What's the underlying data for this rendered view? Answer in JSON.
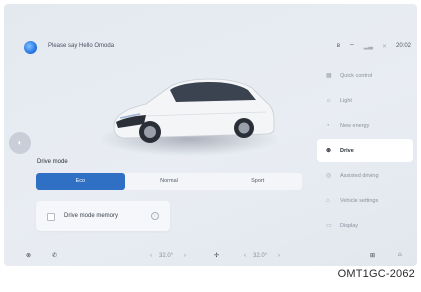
{
  "header": {
    "greeting": "Please say Hello Omoda",
    "status_icons": [
      "bluetooth-icon",
      "wifi-icon",
      "signal-icon",
      "mute-icon"
    ],
    "time": "20:02"
  },
  "drive_mode": {
    "label": "Drive mode",
    "options": [
      "Eco",
      "Normal",
      "Sport"
    ],
    "selected": "Eco"
  },
  "drive_mode_memory": {
    "label": "Drive mode memory"
  },
  "menu": {
    "items": [
      {
        "icon": "quick-control-icon",
        "label": "Quick control"
      },
      {
        "icon": "light-icon",
        "label": "Light"
      },
      {
        "icon": "new-energy-icon",
        "label": "New energy"
      },
      {
        "icon": "drive-icon",
        "label": "Drive"
      },
      {
        "icon": "assisted-driving-icon",
        "label": "Assisted driving"
      },
      {
        "icon": "vehicle-settings-icon",
        "label": "Vehicle settings"
      },
      {
        "icon": "display-icon",
        "label": "Display"
      }
    ],
    "active": "Drive"
  },
  "bottom_bar": {
    "left_temp": "32.0°",
    "right_temp": "32.0°"
  },
  "reference_code": "OMT1GC-2062"
}
